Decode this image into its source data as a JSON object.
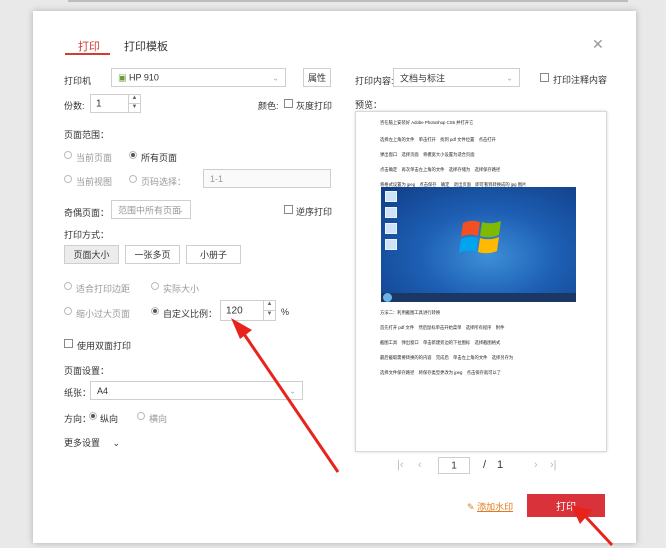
{
  "tabs": [
    {
      "label": "打印"
    },
    {
      "label": "打印模板"
    }
  ],
  "printer": {
    "label": "打印机",
    "value": "HP 910",
    "properties_button": "属性"
  },
  "copies": {
    "label": "份数:",
    "value": "1"
  },
  "color": {
    "label": "颜色:",
    "grayscale_label": "灰度打印",
    "grayscale_checked": false
  },
  "page_range": {
    "title": "页面范围：",
    "current_page": "当前页面",
    "all_pages": "所有页面",
    "current_view": "当前视图",
    "page_select": "页码选择：",
    "page_select_placeholder": "1-1",
    "selected": "all_pages"
  },
  "odd_even": {
    "label": "奇偶页面：",
    "value": "范围中所有页面",
    "reverse_label": "逆序打印"
  },
  "print_mode": {
    "title": "打印方式：",
    "buttons": [
      "页面大小",
      "一张多页",
      "小册子"
    ],
    "selected": "页面大小"
  },
  "scaling": {
    "fit_margins": "适合打印边距",
    "actual_size": "实际大小",
    "shrink_oversized": "缩小过大页面",
    "custom_scale": "自定义比例：",
    "custom_value": "120",
    "unit": "%",
    "selected": "custom_scale"
  },
  "duplex": {
    "label": "使用双面打印",
    "checked": false
  },
  "page_setup": {
    "title": "页面设置：",
    "paper_label": "纸张：",
    "paper_value": "A4",
    "orientation_label": "方向：",
    "portrait": "纵向",
    "landscape": "横向",
    "selected": "portrait"
  },
  "more_settings": "更多设置",
  "print_content": {
    "label": "打印内容:",
    "value": "文档与标注",
    "annotations_label": "打印注释内容"
  },
  "preview": {
    "label": "预览：",
    "lines_top": [
      "咨在脑上安装好 Adobe Photoshop CS6 并打开它",
      "选择左上角的文件　单击打开　找到 pdf 文件位置　点击打开",
      "弹出窗口　选择页面　将模宽大小设置为适合页面",
      "点击确定　再次单击左上角的文件　选择存储为　选择保存路径",
      "将格式设置为 jpeg　点击保存　确定　退出页面　即可看到转换成的 jpg 图片"
    ],
    "lines_bottom": [
      "方法二：利用截图工具进行转换",
      "首先打开 pdf 文件　然后鼠标单击开始菜单　选择所有程序　附件",
      "截图工具　弹出窗口　单击新建旁边的下拉图标　选择截图格式",
      "最后截取需要转换的的内容　完成后　单击左上角的文件　选择另存为",
      "选择文件保存路径　将保存类型更改为 jpeg　点击保存就可以了"
    ]
  },
  "pager": {
    "current": "1",
    "separator": "/",
    "total": "1"
  },
  "footer": {
    "watermark_label": "添加水印",
    "print_button": "打印"
  }
}
